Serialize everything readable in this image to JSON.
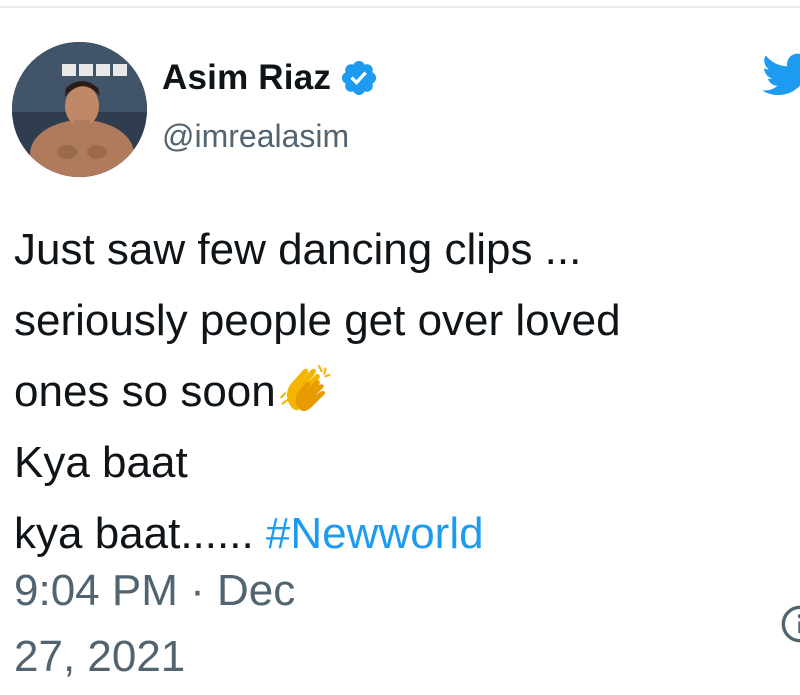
{
  "author": {
    "display_name": "Asim Riaz",
    "handle": "@imrealasim",
    "verified": true
  },
  "tweet": {
    "lines": [
      "Just saw few dancing clips ...",
      "seriously people get over loved",
      "ones so soon",
      "Kya baat",
      "kya baat......"
    ],
    "hashtag": "#Newworld",
    "emoji": "clapping-hands-icon"
  },
  "timestamp": {
    "line1": "9:04 PM · Dec",
    "line2": "27, 2021"
  },
  "icons": {
    "brand": "twitter-bird-icon",
    "verified": "verified-badge-icon",
    "info": "info-icon"
  },
  "colors": {
    "accent": "#1d9bf0",
    "text": "#0f1419",
    "secondary": "#536471"
  }
}
